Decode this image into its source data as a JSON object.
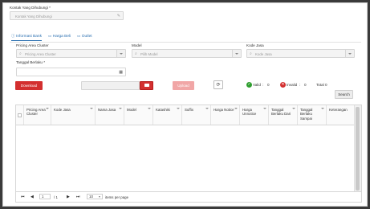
{
  "form": {
    "kontak_label": "Kontak Yang Dihubungi *",
    "kontak_placeholder": "Kontak Yang Dihubungi",
    "pricing_label": "Pricing Area Cluster",
    "pricing_placeholder": "Pricing Area Cluster",
    "model_label": "Model",
    "model_placeholder": "Pilih Model",
    "kode_label": "Kode Jasa",
    "kode_placeholder": "Kode Jasa",
    "tanggal_label": "Tanggal Berlaku *"
  },
  "tabs": [
    {
      "label": "Informasi Bank",
      "icon": "info-icon"
    },
    {
      "label": "Harga Beli",
      "icon": "tag-icon"
    },
    {
      "label": "Outlet",
      "icon": "store-icon"
    }
  ],
  "toolbar": {
    "download_label": "Download",
    "upload_label": "Upload",
    "valid_label": "Valid",
    "valid_count": "0",
    "invalid_label": "Invalid",
    "invalid_count": "0",
    "total_label": "Total 0",
    "search_label": "Search"
  },
  "colors": {
    "download": "#d32f2f",
    "upload": "#f1a6a6",
    "valid": "#2e9e2e",
    "invalid": "#d32f2f",
    "tab": "#2a6fb0"
  },
  "grid": {
    "columns": [
      {
        "label": "Pricing Area Cluster"
      },
      {
        "label": "Kode Jasa"
      },
      {
        "label": "Nama Jasa"
      },
      {
        "label": "Model"
      },
      {
        "label": "Katashiki"
      },
      {
        "label": "Suffix"
      },
      {
        "label": "Harga Notice"
      },
      {
        "label": "Harga Unnotice"
      },
      {
        "label": "Tanggal Berlaku Dari"
      },
      {
        "label": "Tanggal Berlaku Sampai"
      },
      {
        "label": "Keterangan"
      }
    ]
  },
  "pager": {
    "page": "1",
    "of": "/ 1",
    "page_size": "10",
    "items_label": "items per page"
  }
}
